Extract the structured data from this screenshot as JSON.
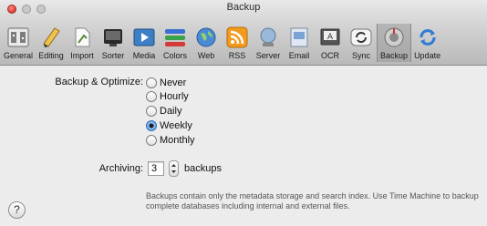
{
  "window": {
    "title": "Backup"
  },
  "toolbar": {
    "items": [
      {
        "label": "General",
        "icon": "general-icon"
      },
      {
        "label": "Editing",
        "icon": "pencil-icon"
      },
      {
        "label": "Import",
        "icon": "import-icon"
      },
      {
        "label": "Sorter",
        "icon": "sorter-icon"
      },
      {
        "label": "Media",
        "icon": "media-icon"
      },
      {
        "label": "Colors",
        "icon": "colors-icon"
      },
      {
        "label": "Web",
        "icon": "globe-icon"
      },
      {
        "label": "RSS",
        "icon": "rss-icon"
      },
      {
        "label": "Server",
        "icon": "server-icon"
      },
      {
        "label": "Email",
        "icon": "email-icon"
      },
      {
        "label": "OCR",
        "icon": "ocr-icon"
      },
      {
        "label": "Sync",
        "icon": "sync-icon"
      },
      {
        "label": "Backup",
        "icon": "backup-icon",
        "selected": true
      },
      {
        "label": "Update",
        "icon": "update-icon"
      }
    ]
  },
  "backup": {
    "label": "Backup & Optimize:",
    "options": [
      {
        "label": "Never",
        "checked": false
      },
      {
        "label": "Hourly",
        "checked": false
      },
      {
        "label": "Daily",
        "checked": false
      },
      {
        "label": "Weekly",
        "checked": true
      },
      {
        "label": "Monthly",
        "checked": false
      }
    ]
  },
  "archiving": {
    "label": "Archiving:",
    "value": "3",
    "suffix": "backups"
  },
  "help_text": "Backups contain only the metadata storage and search index. Use Time Machine to backup complete databases including internal and external files.",
  "help_button": {
    "label": "?"
  },
  "colors": {
    "radio_selected": "#4e92e3",
    "close_button": "#e0443a"
  }
}
